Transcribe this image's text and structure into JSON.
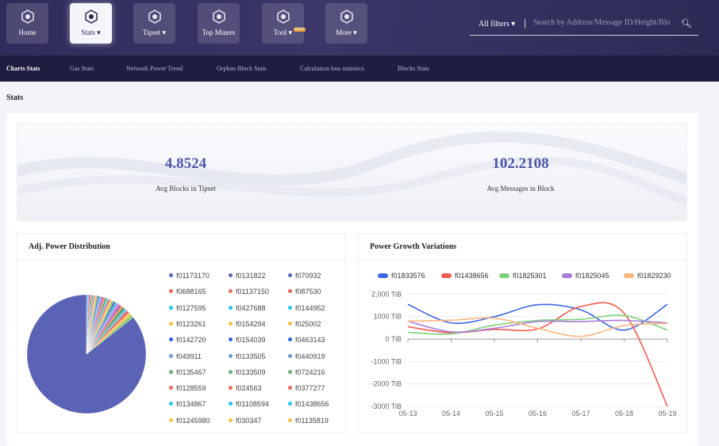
{
  "nav": [
    {
      "label": "Home",
      "icon": "home-cube-icon"
    },
    {
      "label": "Stats ▾",
      "icon": "sliders-icon",
      "active": true
    },
    {
      "label": "Tipset ▾",
      "icon": "tipset-chain-icon"
    },
    {
      "label": "Top Miners",
      "icon": "globe-icon"
    },
    {
      "label": "Tool ▾",
      "icon": "tool-cube-icon",
      "badge": "NEW"
    },
    {
      "label": "More ▾",
      "icon": "more-sphere-icon"
    }
  ],
  "search": {
    "filter": "All filters",
    "placeholder": "Search by Address/Message ID/Height/Blo"
  },
  "subnav": [
    "Charts Stats",
    "Gas Stats",
    "Network Power Trend",
    "Orphan Block Stats",
    "Calculation loss statistics",
    "Blocks Stats"
  ],
  "page_title": "Stats",
  "summary": [
    {
      "value": "4.8524",
      "label": "Avg Blocks in Tipset"
    },
    {
      "value": "102.2108",
      "label": "Avg Messages in Block"
    }
  ],
  "chart_data": [
    {
      "type": "pie",
      "title": "Adj. Power Distribution",
      "labels": [
        "f01173170",
        "f0131822",
        "f070932",
        "f0688165",
        "f01137150",
        "f087530",
        "f0127595",
        "f0427688",
        "f0144952",
        "f0123261",
        "f0154294",
        "f025002",
        "f0142720",
        "f0154039",
        "f0463143",
        "f049911",
        "f0133505",
        "f0440919",
        "f0135467",
        "f0133509",
        "f0724216",
        "f0128559",
        "f024563",
        "f0377277",
        "f0134867",
        "f01108594",
        "f01438656",
        "f01245980",
        "f030347",
        "f01135819"
      ],
      "values": [
        85,
        0.9,
        0.8,
        0.8,
        0.7,
        0.7,
        0.6,
        0.6,
        0.6,
        0.55,
        0.55,
        0.5,
        0.5,
        0.5,
        0.5,
        0.45,
        0.45,
        0.45,
        0.4,
        0.4,
        0.4,
        0.4,
        0.35,
        0.35,
        0.35,
        0.3,
        0.3,
        0.3,
        0.3,
        0.3
      ],
      "row_colors": [
        "#5b63b7",
        "#f2665e",
        "#1ec8f2",
        "#f5c242",
        "#2d5cf0",
        "#6a9bc9",
        "#6faa72",
        "#f2665e",
        "#1ec8f2",
        "#f5c242"
      ]
    },
    {
      "type": "line",
      "title": "Power Growth Variations",
      "x": [
        "05-13",
        "05-14",
        "05-15",
        "05-16",
        "05-17",
        "05-18",
        "05-19"
      ],
      "yticks": [
        "2,000 TiB",
        "1000 TiB",
        "0 TiB",
        "-1000 TiB",
        "-2000 TiB",
        "-3000 TiB"
      ],
      "ylim": [
        -3000,
        2000
      ],
      "unit": "TiB",
      "series": [
        {
          "name": "f01833576",
          "color": "#3d67e6",
          "values": [
            1550,
            720,
            1000,
            1530,
            1300,
            400,
            1550
          ]
        },
        {
          "name": "f01438656",
          "color": "#f45b50",
          "values": [
            550,
            280,
            430,
            450,
            1450,
            1150,
            -3000
          ]
        },
        {
          "name": "f01825301",
          "color": "#7fcf7a",
          "values": [
            300,
            230,
            620,
            830,
            880,
            1050,
            400
          ]
        },
        {
          "name": "f01825045",
          "color": "#a97dd8",
          "values": [
            800,
            320,
            480,
            780,
            780,
            830,
            720
          ]
        },
        {
          "name": "f01829230",
          "color": "#fdb57d",
          "values": [
            800,
            840,
            930,
            480,
            120,
            600,
            700
          ]
        }
      ]
    }
  ]
}
